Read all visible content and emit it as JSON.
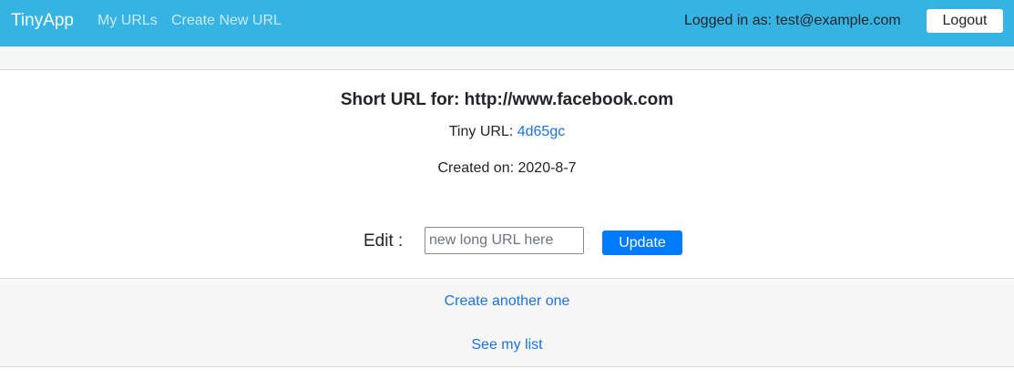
{
  "navbar": {
    "brand": "TinyApp",
    "links": [
      "My URLs",
      "Create New URL"
    ],
    "login_status": "Logged in as: test@example.com",
    "logout_label": "Logout"
  },
  "url_details": {
    "title": "Short URL for: http://www.facebook.com",
    "tiny_label": "Tiny URL: ",
    "tiny_code": "4d65gc",
    "created_label": "Created on: 2020-8-7"
  },
  "edit_form": {
    "label": "Edit :",
    "value": "",
    "placeholder": "new long URL here",
    "submit_label": "Update"
  },
  "footer": {
    "links": [
      "Create another one",
      "See my list"
    ]
  },
  "colors": {
    "navbar_bg": "#35b4e4",
    "link": "#1a73e8",
    "primary_button": "#007bff",
    "strip_bg": "#f7f7f7"
  }
}
